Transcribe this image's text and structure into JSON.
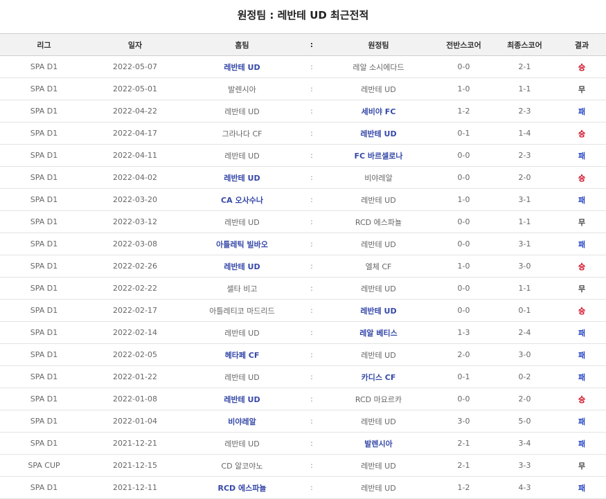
{
  "title": "원정팀 : 레반테 UD 최근전적",
  "headers": [
    "리그",
    "일자",
    "홈팀",
    ":",
    "원정팀",
    "전반스코어",
    "최종스코어",
    "결과"
  ],
  "rows": [
    {
      "league": "SPA D1",
      "date": "2022-05-07",
      "home": "레반테 UD",
      "sep": ":",
      "away": "레알 소시에다드",
      "half": "0-0",
      "final": "2-1",
      "result": "승",
      "winner": "home",
      "rtype": "win"
    },
    {
      "league": "SPA D1",
      "date": "2022-05-01",
      "home": "발렌시아",
      "sep": ":",
      "away": "레반테 UD",
      "half": "1-0",
      "final": "1-1",
      "result": "무",
      "winner": "none",
      "rtype": "draw"
    },
    {
      "league": "SPA D1",
      "date": "2022-04-22",
      "home": "레반테 UD",
      "sep": ":",
      "away": "세비야 FC",
      "half": "1-2",
      "final": "2-3",
      "result": "패",
      "winner": "away",
      "rtype": "loss"
    },
    {
      "league": "SPA D1",
      "date": "2022-04-17",
      "home": "그라나다 CF",
      "sep": ":",
      "away": "레반테 UD",
      "half": "0-1",
      "final": "1-4",
      "result": "승",
      "winner": "away",
      "rtype": "win"
    },
    {
      "league": "SPA D1",
      "date": "2022-04-11",
      "home": "레반테 UD",
      "sep": ":",
      "away": "FC 바르셀로나",
      "half": "0-0",
      "final": "2-3",
      "result": "패",
      "winner": "away",
      "rtype": "loss"
    },
    {
      "league": "SPA D1",
      "date": "2022-04-02",
      "home": "레반테 UD",
      "sep": ":",
      "away": "비야레알",
      "half": "0-0",
      "final": "2-0",
      "result": "승",
      "winner": "home",
      "rtype": "win"
    },
    {
      "league": "SPA D1",
      "date": "2022-03-20",
      "home": "CA 오사수나",
      "sep": ":",
      "away": "레반테 UD",
      "half": "1-0",
      "final": "3-1",
      "result": "패",
      "winner": "home",
      "rtype": "loss"
    },
    {
      "league": "SPA D1",
      "date": "2022-03-12",
      "home": "레반테 UD",
      "sep": ":",
      "away": "RCD 에스파뇰",
      "half": "0-0",
      "final": "1-1",
      "result": "무",
      "winner": "none",
      "rtype": "draw"
    },
    {
      "league": "SPA D1",
      "date": "2022-03-08",
      "home": "아틀레틱 빌바오",
      "sep": ":",
      "away": "레반테 UD",
      "half": "0-0",
      "final": "3-1",
      "result": "패",
      "winner": "home",
      "rtype": "loss"
    },
    {
      "league": "SPA D1",
      "date": "2022-02-26",
      "home": "레반테 UD",
      "sep": ":",
      "away": "엘체 CF",
      "half": "1-0",
      "final": "3-0",
      "result": "승",
      "winner": "home",
      "rtype": "win"
    },
    {
      "league": "SPA D1",
      "date": "2022-02-22",
      "home": "셀타 비고",
      "sep": ":",
      "away": "레반테 UD",
      "half": "0-0",
      "final": "1-1",
      "result": "무",
      "winner": "none",
      "rtype": "draw"
    },
    {
      "league": "SPA D1",
      "date": "2022-02-17",
      "home": "아틀레티코 마드리드",
      "sep": ":",
      "away": "레반테 UD",
      "half": "0-0",
      "final": "0-1",
      "result": "승",
      "winner": "away",
      "rtype": "win"
    },
    {
      "league": "SPA D1",
      "date": "2022-02-14",
      "home": "레반테 UD",
      "sep": ":",
      "away": "레알 베티스",
      "half": "1-3",
      "final": "2-4",
      "result": "패",
      "winner": "away",
      "rtype": "loss"
    },
    {
      "league": "SPA D1",
      "date": "2022-02-05",
      "home": "헤타페 CF",
      "sep": ":",
      "away": "레반테 UD",
      "half": "2-0",
      "final": "3-0",
      "result": "패",
      "winner": "home",
      "rtype": "loss"
    },
    {
      "league": "SPA D1",
      "date": "2022-01-22",
      "home": "레반테 UD",
      "sep": ":",
      "away": "카디스 CF",
      "half": "0-1",
      "final": "0-2",
      "result": "패",
      "winner": "away",
      "rtype": "loss"
    },
    {
      "league": "SPA D1",
      "date": "2022-01-08",
      "home": "레반테 UD",
      "sep": ":",
      "away": "RCD 마요르카",
      "half": "0-0",
      "final": "2-0",
      "result": "승",
      "winner": "home",
      "rtype": "win"
    },
    {
      "league": "SPA D1",
      "date": "2022-01-04",
      "home": "비야레알",
      "sep": ":",
      "away": "레반테 UD",
      "half": "3-0",
      "final": "5-0",
      "result": "패",
      "winner": "home",
      "rtype": "loss"
    },
    {
      "league": "SPA D1",
      "date": "2021-12-21",
      "home": "레반테 UD",
      "sep": ":",
      "away": "발렌시아",
      "half": "2-1",
      "final": "3-4",
      "result": "패",
      "winner": "away",
      "rtype": "loss"
    },
    {
      "league": "SPA CUP",
      "date": "2021-12-15",
      "home": "CD 알코야노",
      "sep": ":",
      "away": "레반테 UD",
      "half": "2-1",
      "final": "3-3",
      "result": "무",
      "winner": "none",
      "rtype": "draw"
    },
    {
      "league": "SPA D1",
      "date": "2021-12-11",
      "home": "RCD 에스파뇰",
      "sep": ":",
      "away": "레반테 UD",
      "half": "1-2",
      "final": "4-3",
      "result": "패",
      "winner": "home",
      "rtype": "loss"
    }
  ]
}
